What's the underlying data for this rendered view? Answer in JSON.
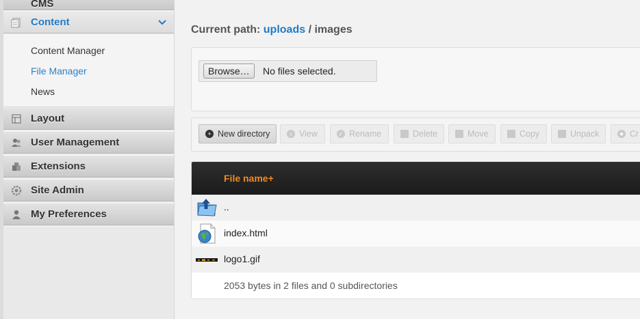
{
  "sidebar": {
    "top_partial_label": "CMS",
    "sections": [
      {
        "label": "Content",
        "icon": "content-icon"
      },
      {
        "label": "Layout",
        "icon": "layout-icon"
      },
      {
        "label": "User Management",
        "icon": "users-icon"
      },
      {
        "label": "Extensions",
        "icon": "puzzle-icon"
      },
      {
        "label": "Site Admin",
        "icon": "gear-icon"
      },
      {
        "label": "My Preferences",
        "icon": "person-icon"
      }
    ],
    "content_items": [
      {
        "label": "Content Manager"
      },
      {
        "label": "File Manager",
        "current": true
      },
      {
        "label": "News"
      }
    ],
    "accent_color": "#1f7ac7"
  },
  "path": {
    "prefix": "Current path:",
    "link": "uploads",
    "separator": "/",
    "current": "images"
  },
  "upload": {
    "browse_label": "Browse…",
    "status": "No files selected."
  },
  "toolbar": {
    "buttons": [
      {
        "label": "New directory",
        "icon": "plus-circle-icon",
        "enabled": true
      },
      {
        "label": "View",
        "icon": "search-icon",
        "enabled": false
      },
      {
        "label": "Rename",
        "icon": "check-icon",
        "enabled": false
      },
      {
        "label": "Delete",
        "icon": "trash-icon",
        "enabled": false
      },
      {
        "label": "Move",
        "icon": "move-icon",
        "enabled": false
      },
      {
        "label": "Copy",
        "icon": "copy-icon",
        "enabled": false
      },
      {
        "label": "Unpack",
        "icon": "unpack-icon",
        "enabled": false
      },
      {
        "label": "Cr",
        "icon": "star-icon",
        "enabled": false
      }
    ]
  },
  "table": {
    "header": "File name+",
    "header_color": "#f08a24",
    "rows": [
      {
        "name": "..",
        "icon": "folder-up-icon"
      },
      {
        "name": "index.html",
        "icon": "html-file-icon"
      },
      {
        "name": "logo1.gif",
        "icon": "gif-thumbnail-icon"
      }
    ],
    "summary": "2053 bytes in 2 files and 0 subdirectories"
  }
}
